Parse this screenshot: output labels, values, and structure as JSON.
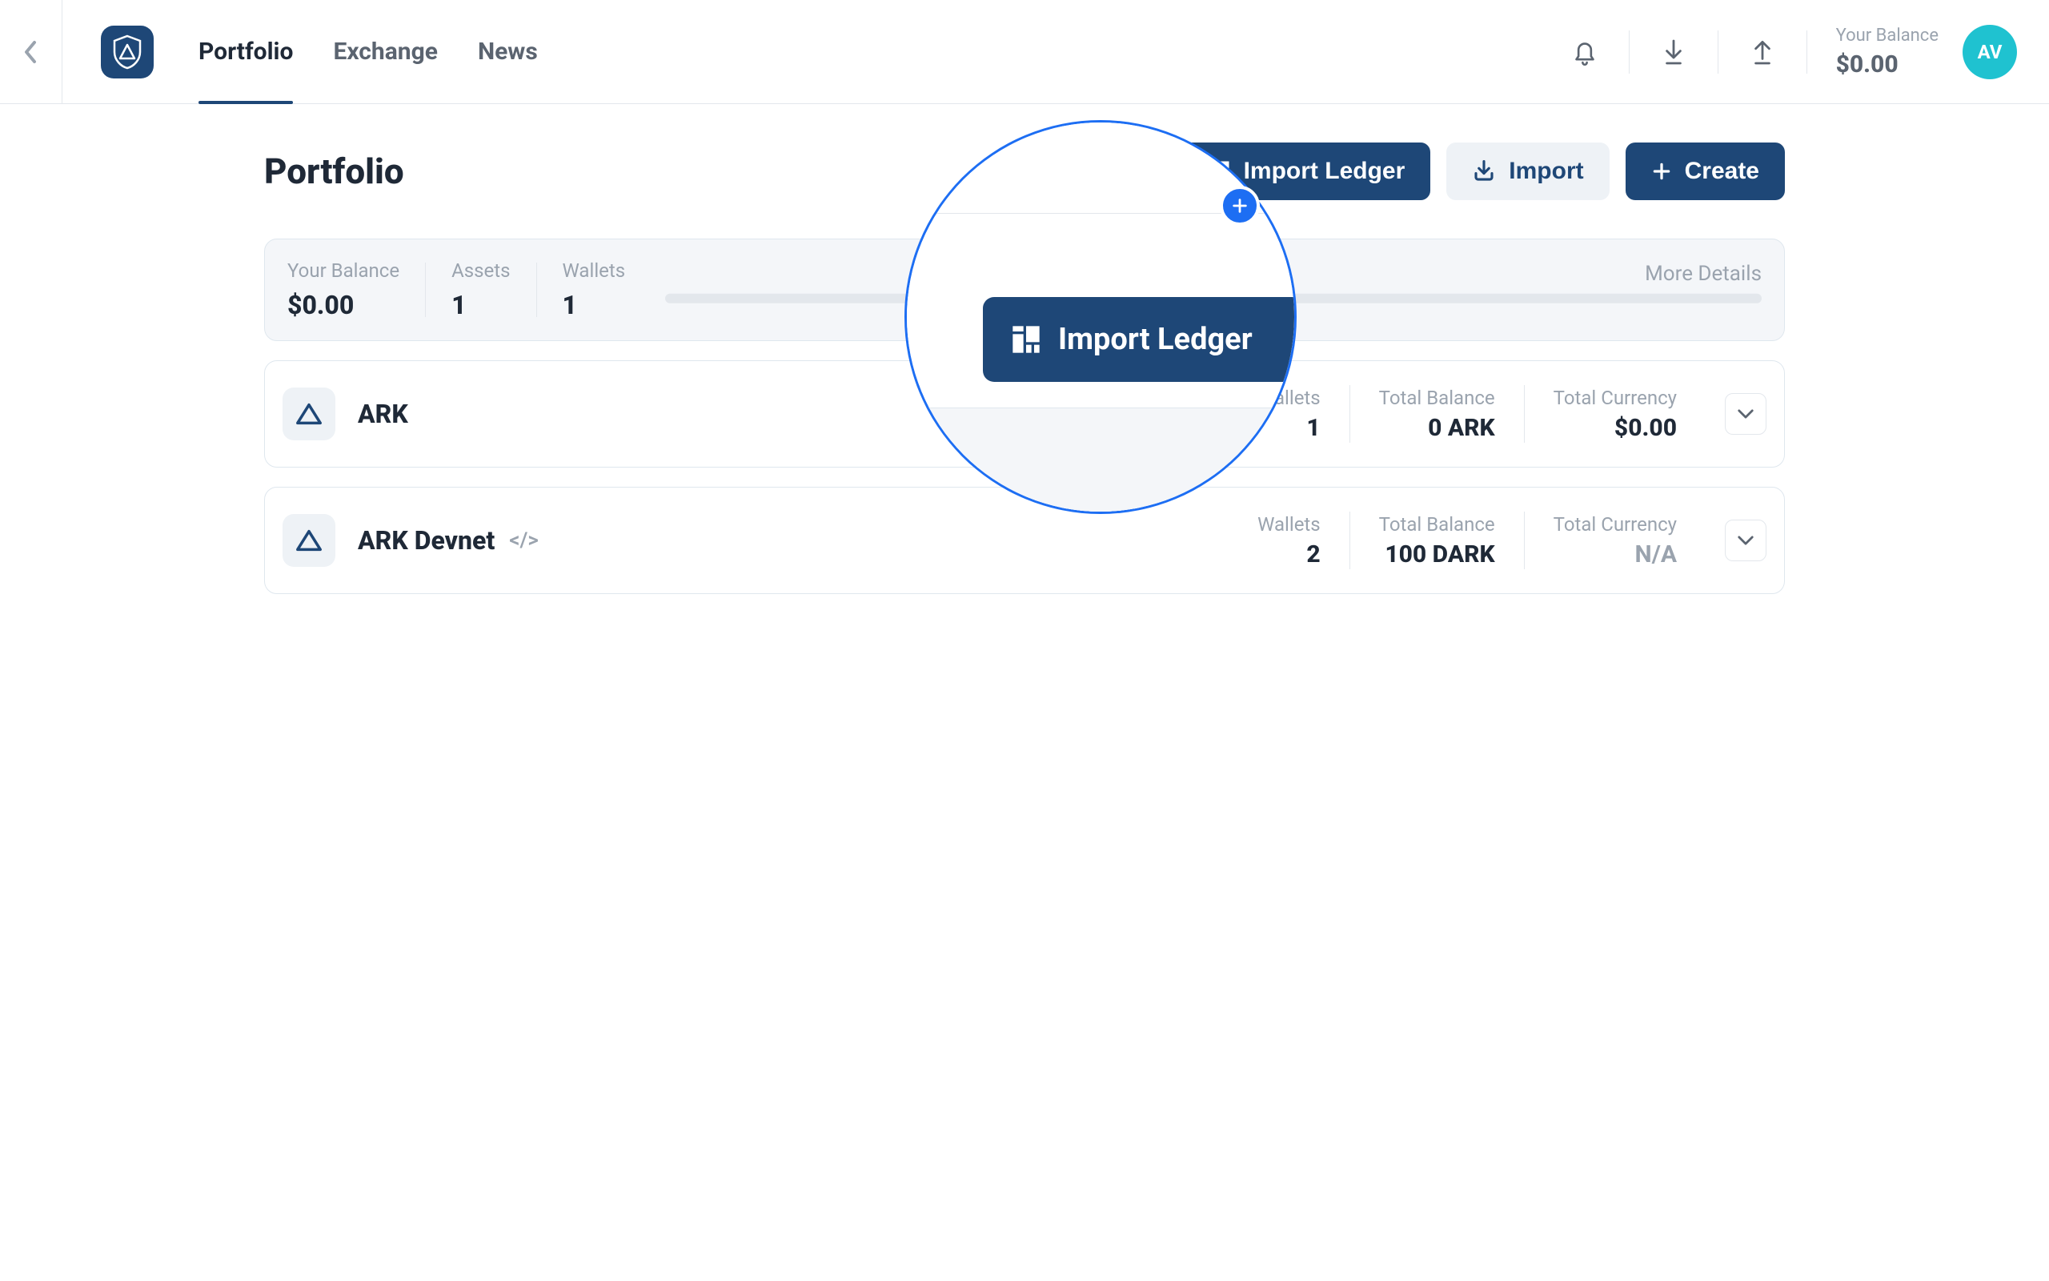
{
  "header": {
    "nav": [
      "Portfolio",
      "Exchange",
      "News"
    ],
    "active_nav_index": 0,
    "balance_label": "Your Balance",
    "balance_value": "$0.00",
    "avatar_initials": "AV"
  },
  "page": {
    "title": "Portfolio",
    "actions": {
      "import_ledger": "Import Ledger",
      "import": "Import",
      "create": "Create"
    }
  },
  "summary": {
    "balance_label": "Your Balance",
    "balance_value": "$0.00",
    "assets_label": "Assets",
    "assets_value": "1",
    "wallets_label": "Wallets",
    "wallets_value": "1",
    "more_details": "More Details"
  },
  "assets": [
    {
      "name": "ARK",
      "devnet": false,
      "wallets_label": "Wallets",
      "wallets_value": "1",
      "balance_label": "Total Balance",
      "balance_value": "0 ARK",
      "currency_label": "Total Currency",
      "currency_value": "$0.00",
      "currency_muted": false
    },
    {
      "name": "ARK Devnet",
      "devnet": true,
      "wallets_label": "Wallets",
      "wallets_value": "2",
      "balance_label": "Total Balance",
      "balance_value": "100 DARK",
      "currency_label": "Total Currency",
      "currency_value": "N/A",
      "currency_muted": true
    }
  ],
  "magnifier": {
    "button_label": "Import Ledger"
  }
}
